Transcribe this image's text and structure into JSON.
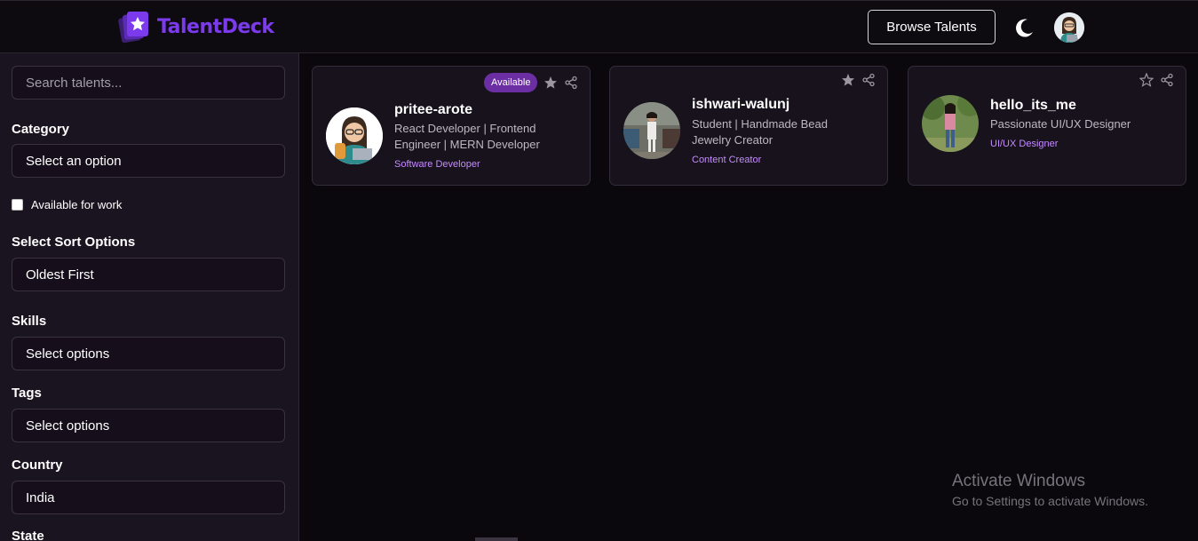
{
  "brand": {
    "name": "TalentDeck",
    "accent": "#7c3aed"
  },
  "header": {
    "browse_label": "Browse Talents",
    "theme_icon": "moon-icon"
  },
  "sidebar": {
    "search_placeholder": "Search talents...",
    "category_label": "Category",
    "category_value": "Select an option",
    "available_label": "Available for work",
    "sort_label": "Select Sort Options",
    "sort_value": "Oldest First",
    "skills_label": "Skills",
    "skills_value": "Select options",
    "tags_label": "Tags",
    "tags_value": "Select options",
    "country_label": "Country",
    "country_value": "India",
    "state_label": "State"
  },
  "cards": [
    {
      "name": "pritee-arote",
      "desc": "React Developer | Frontend Engineer | MERN Developer",
      "role": "Software Developer",
      "badge": "Available"
    },
    {
      "name": "ishwari-walunj",
      "desc": "Student | Handmade Bead Jewelry Creator",
      "role": "Content Creator"
    },
    {
      "name": "hello_its_me",
      "desc": "Passionate UI/UX Designer",
      "role": "UI/UX Designer"
    }
  ],
  "watermark": {
    "line1": "Activate Windows",
    "line2": "Go to Settings to activate Windows."
  }
}
